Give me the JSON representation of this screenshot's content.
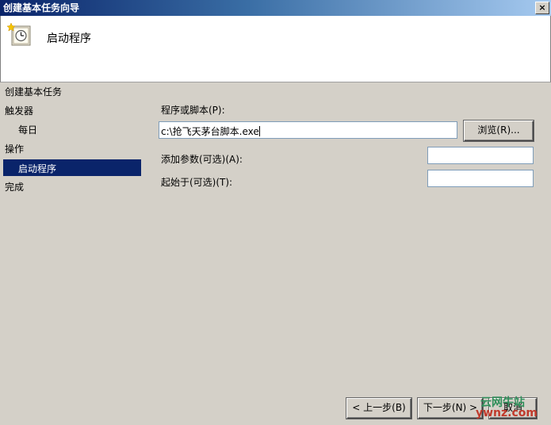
{
  "window": {
    "title": "创建基本任务向导",
    "close_glyph": "×"
  },
  "header": {
    "title": "启动程序",
    "icon": "scheduled-task-clock-icon"
  },
  "nav": {
    "section_title": "创建基本任务",
    "items": [
      "触发器",
      "每日",
      "操作",
      "启动程序",
      "完成"
    ],
    "selected": "启动程序"
  },
  "form": {
    "program_label": "程序或脚本(P):",
    "program_value": "c:\\抢飞天茅台脚本.exe",
    "browse_label": "浏览(R)...",
    "args_label": "添加参数(可选)(A):",
    "args_value": "",
    "start_in_label": "起始于(可选)(T):",
    "start_in_value": ""
  },
  "footer": {
    "back_label": "< 上一步(B)",
    "next_label": "下一步(N) >",
    "cancel_label": "取消"
  },
  "watermark": {
    "line1": "云网牛站",
    "line2": "ywnz.com"
  },
  "colors": {
    "selection": "#0a246a",
    "dialog": "#d4d0c8",
    "title_start": "#0a246a",
    "title_end": "#a6caf0"
  }
}
